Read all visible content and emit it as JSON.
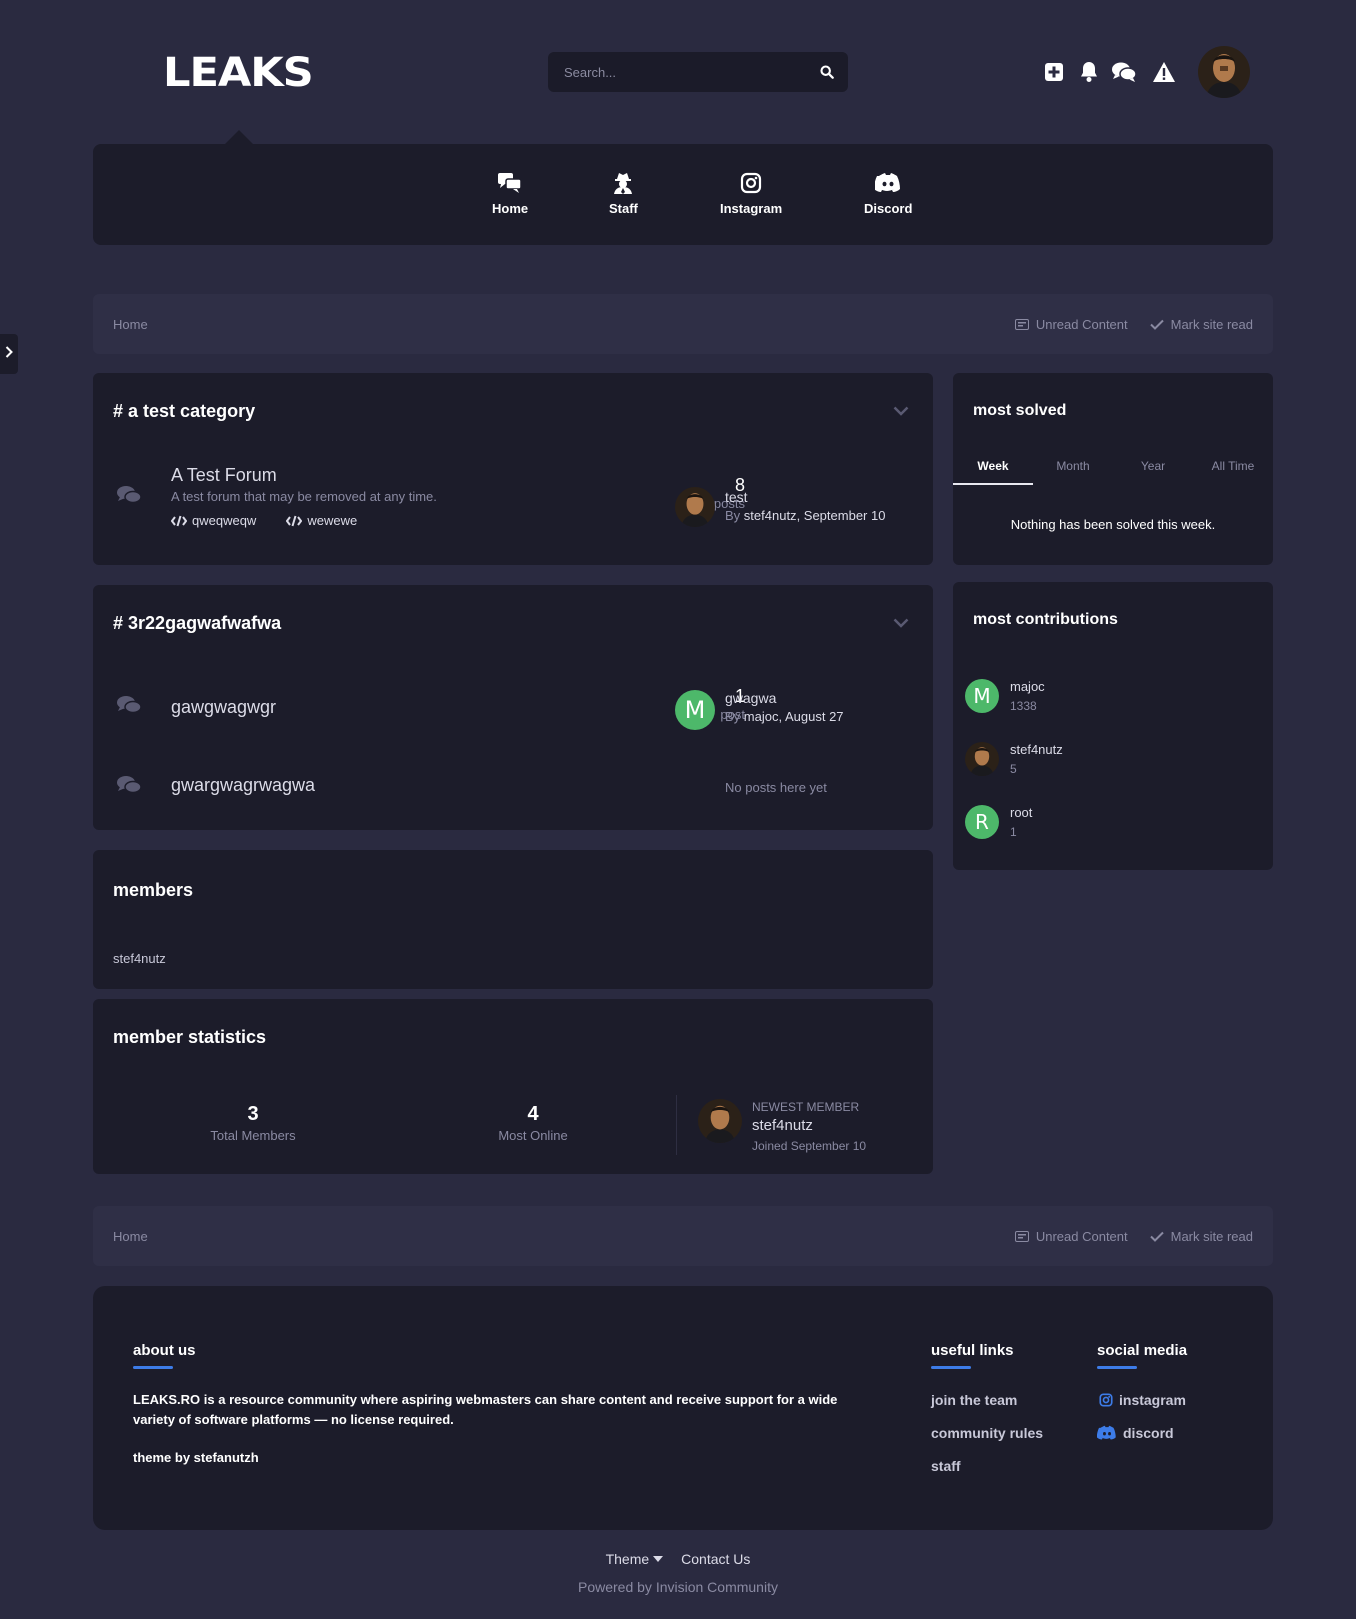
{
  "header": {
    "logo": "LEAKS",
    "search_placeholder": "Search..."
  },
  "icons": {
    "create": "plus-square-icon",
    "notifications": "bell-icon",
    "messages": "comments-icon",
    "reports": "warning-icon",
    "search": "search-icon"
  },
  "nav": {
    "items": [
      {
        "label": "Home",
        "icon": "comments-icon"
      },
      {
        "label": "Staff",
        "icon": "user-secret-icon"
      },
      {
        "label": "Instagram",
        "icon": "instagram-icon"
      },
      {
        "label": "Discord",
        "icon": "discord-icon"
      }
    ]
  },
  "breadcrumb": {
    "home": "Home",
    "unread": "Unread Content",
    "mark_read": "Mark site read"
  },
  "categories": [
    {
      "title": "a test category",
      "hash": "#",
      "forums": [
        {
          "name": "A Test Forum",
          "description": "A test forum that may be removed at any time.",
          "subforums": [
            "qweqweqw",
            "wewewe"
          ],
          "count": "8",
          "count_label": "posts",
          "last_title": "test",
          "last_by": "By",
          "last_user": "stef4nutz",
          "last_date": ", September 10"
        }
      ]
    },
    {
      "title": "3r22gagwafwafwa",
      "hash": "#",
      "forums": [
        {
          "name": "gawgwagwgr",
          "count": "1",
          "count_label": "post",
          "avatar_letter": "M",
          "last_title": "gwagwa",
          "last_by": "By",
          "last_user": "majoc",
          "last_date": ", August 27"
        },
        {
          "name": "gwargwagrwagwa",
          "empty": "No posts here yet"
        }
      ]
    }
  ],
  "members": {
    "title": "members",
    "list": [
      "stef4nutz"
    ]
  },
  "member_stats": {
    "title": "member statistics",
    "total_members": "3",
    "total_members_label": "Total Members",
    "most_online": "4",
    "most_online_label": "Most Online",
    "newest_label": "NEWEST MEMBER",
    "newest_name": "stef4nutz",
    "newest_joined": "Joined September 10"
  },
  "most_solved": {
    "title": "most solved",
    "tabs": [
      "Week",
      "Month",
      "Year",
      "All Time"
    ],
    "active_tab": "Week",
    "empty": "Nothing has been solved this week."
  },
  "most_contributions": {
    "title": "most contributions",
    "users": [
      {
        "name": "majoc",
        "count": "1338",
        "letter": "M"
      },
      {
        "name": "stef4nutz",
        "count": "5"
      },
      {
        "name": "root",
        "count": "1",
        "letter": "R"
      }
    ]
  },
  "footer": {
    "about_title": "about us",
    "about_text": "LEAKS.RO is a resource community where aspiring webmasters can share content and receive support for a wide variety of software platforms — no license required.",
    "theme_by": "theme by stefanutzh",
    "links_title": "useful links",
    "links": [
      "join the team",
      "community rules",
      "staff"
    ],
    "social_title": "social media",
    "social": [
      {
        "label": "instagram",
        "icon": "instagram-icon"
      },
      {
        "label": "discord",
        "icon": "discord-icon"
      }
    ],
    "bottom_theme": "Theme",
    "bottom_contact": "Contact Us",
    "powered": "Powered by Invision Community"
  },
  "colors": {
    "page_bg": "#2a2a40",
    "card_bg": "#1c1c2a",
    "accent": "#3d7ce8",
    "avatar_green": "#4db86a"
  }
}
